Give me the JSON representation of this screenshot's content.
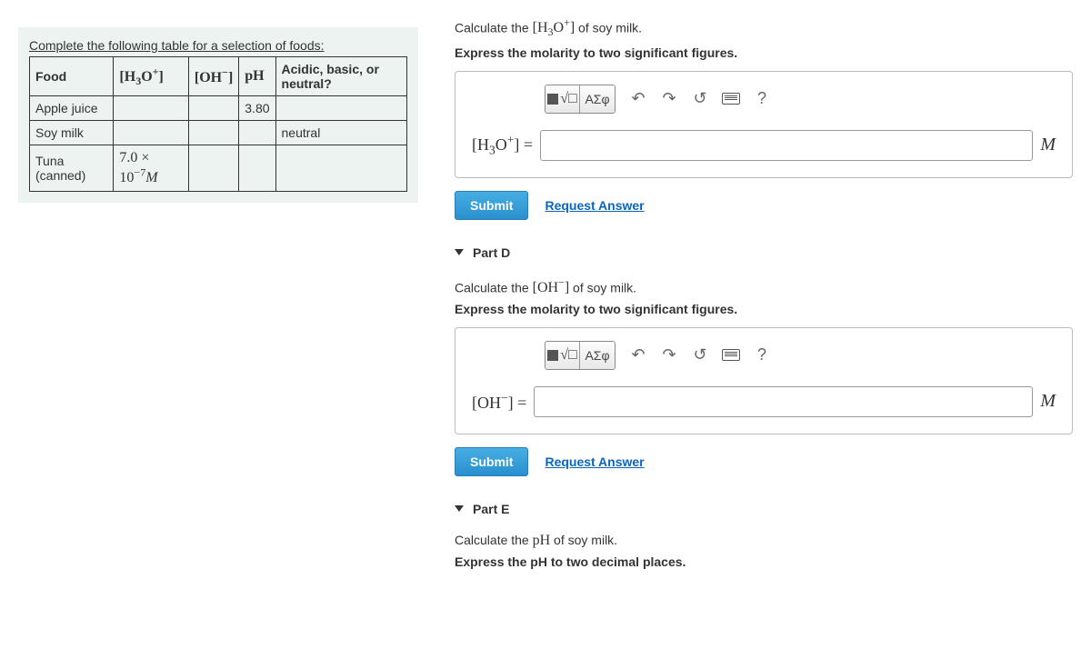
{
  "table": {
    "caption": "Complete the following table for a selection of foods:",
    "headers": {
      "food": "Food",
      "h3o": "[H₃O⁺]",
      "oh": "[OH⁻]",
      "ph": "pH",
      "abn": "Acidic, basic, or neutral?"
    },
    "rows": [
      {
        "food": "Apple juice",
        "h3o": "",
        "oh": "",
        "ph": "3.80",
        "abn": ""
      },
      {
        "food": "Soy milk",
        "h3o": "",
        "oh": "",
        "ph": "",
        "abn": "neutral"
      },
      {
        "food": "Tuna (canned)",
        "h3o": "7.0 × 10⁻⁷ M",
        "oh": "",
        "ph": "",
        "abn": ""
      }
    ]
  },
  "partC": {
    "prompt_html": "Calculate the [H₃O⁺] of soy milk.",
    "instr": "Express the molarity to two significant figures.",
    "label": "[H₃O⁺] =",
    "unit": "M"
  },
  "partD": {
    "title": "Part D",
    "prompt_html": "Calculate the [OH⁻] of soy milk.",
    "instr": "Express the molarity to two significant figures.",
    "label": "[OH⁻] =",
    "unit": "M"
  },
  "partE": {
    "title": "Part E",
    "prompt_html": "Calculate the pH of soy milk.",
    "instr": "Express the pH to two decimal places."
  },
  "toolbar": {
    "greek": "ΑΣφ"
  },
  "buttons": {
    "submit": "Submit",
    "request": "Request Answer",
    "help": "?"
  }
}
